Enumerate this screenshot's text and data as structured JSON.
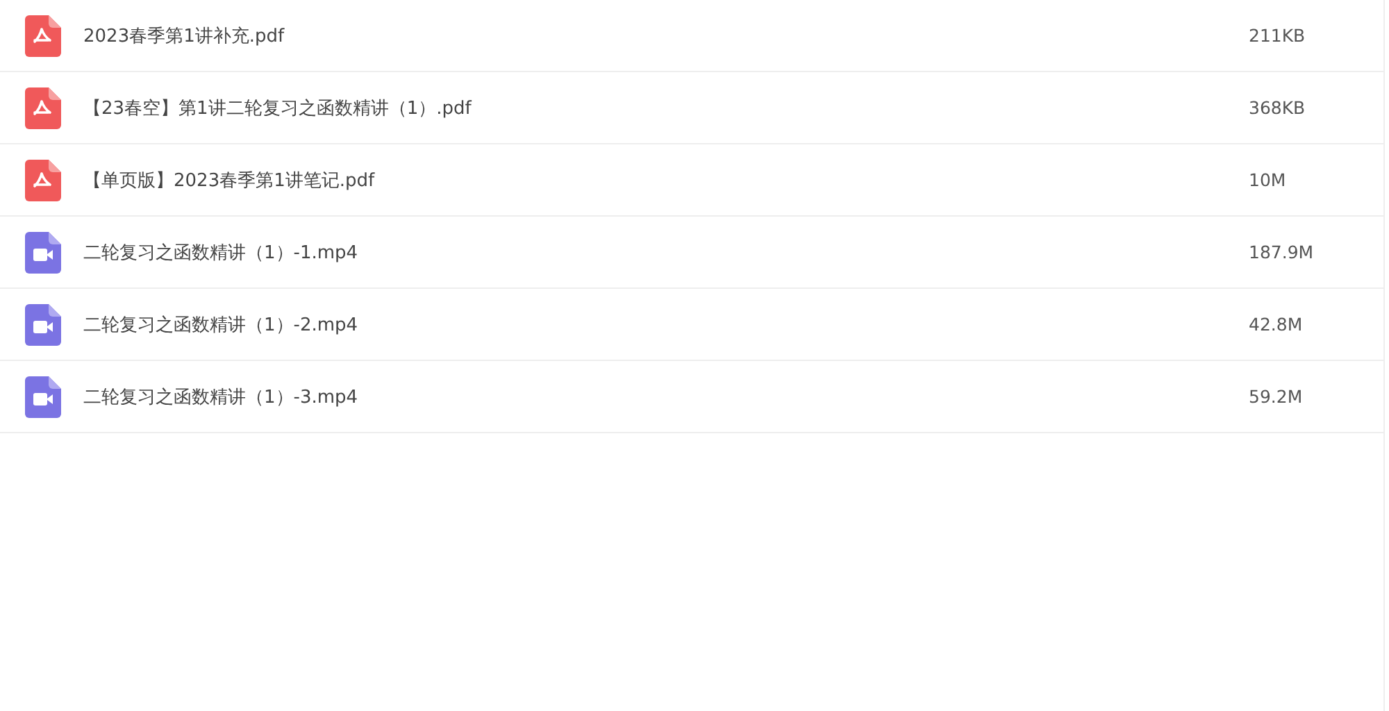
{
  "files": [
    {
      "kind": "pdf",
      "name": "2023春季第1讲补充.pdf",
      "size": "211KB"
    },
    {
      "kind": "pdf",
      "name": "【23春空】第1讲二轮复习之函数精讲（1）.pdf",
      "size": "368KB"
    },
    {
      "kind": "pdf",
      "name": "【单页版】2023春季第1讲笔记.pdf",
      "size": "10M"
    },
    {
      "kind": "video",
      "name": "二轮复习之函数精讲（1）-1.mp4",
      "size": "187.9M"
    },
    {
      "kind": "video",
      "name": "二轮复习之函数精讲（1）-2.mp4",
      "size": "42.8M"
    },
    {
      "kind": "video",
      "name": "二轮复习之函数精讲（1）-3.mp4",
      "size": "59.2M"
    }
  ]
}
